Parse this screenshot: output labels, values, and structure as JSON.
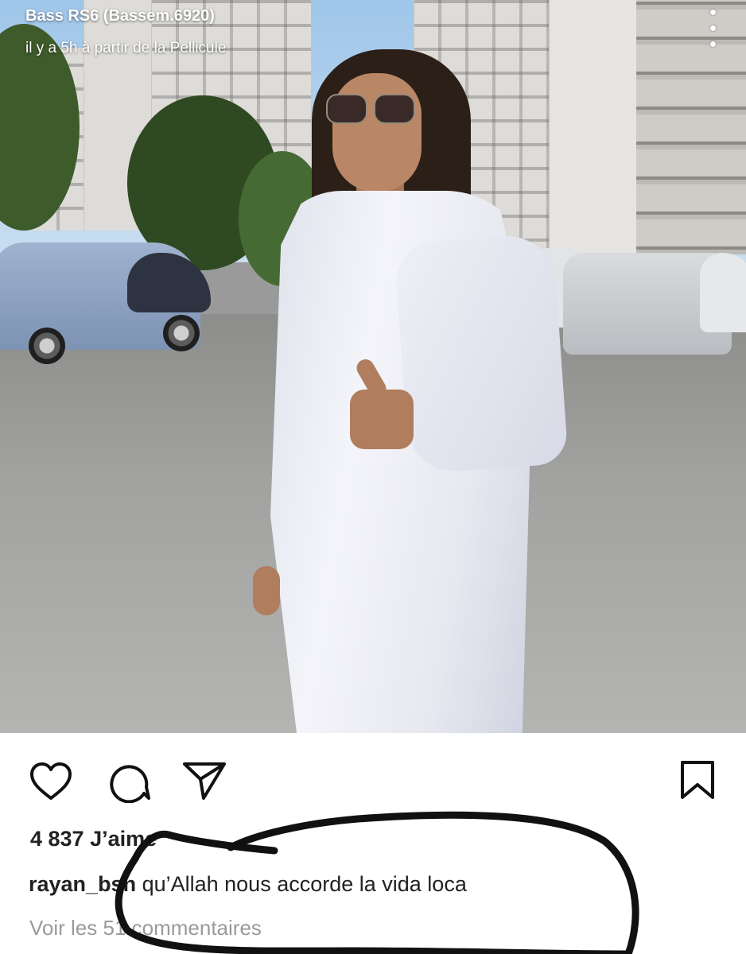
{
  "story_header": {
    "author": "Bass RS6 (Bassem.6920)",
    "subtitle": "il y a 5h à partir de la Pellicule"
  },
  "post": {
    "likes_text": "4 837 J’aime",
    "caption_username": "rayan_bsn",
    "caption_text": " qu’Allah nous accorde la vida loca",
    "view_comments": "Voir les 51 commentaires"
  },
  "icons": {
    "more": "more-vertical-icon",
    "like": "heart-icon",
    "comment": "comment-icon",
    "share": "paper-plane-icon",
    "save": "bookmark-icon"
  },
  "colors": {
    "text": "#222222",
    "muted": "#9a9a9a",
    "scribble": "#111111"
  }
}
